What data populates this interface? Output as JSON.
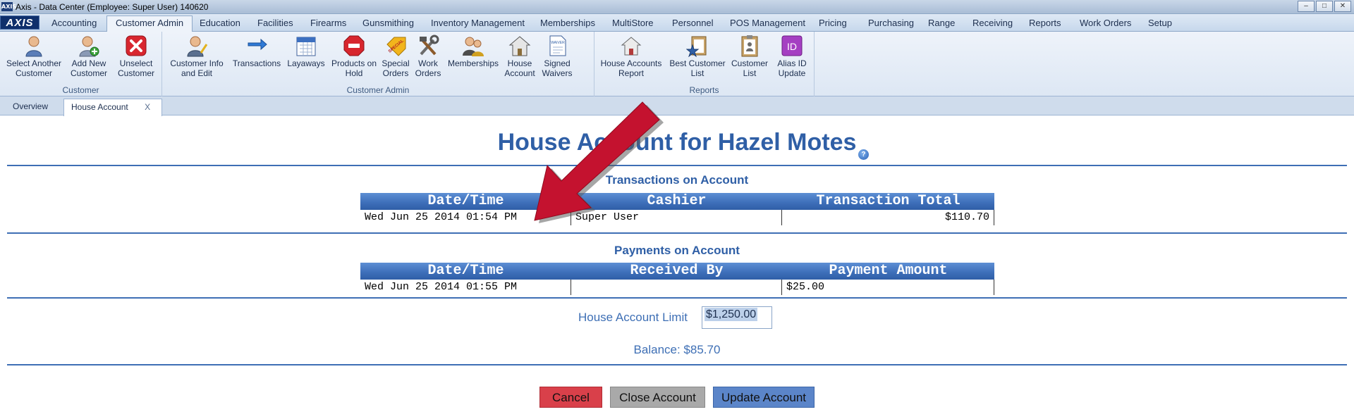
{
  "window": {
    "title": "Axis - Data Center  (Employee: Super User) 140620",
    "app_icon": "AXIS",
    "controls": {
      "minimize": "–",
      "maximize": "□",
      "close": "✕"
    }
  },
  "menu": {
    "logo": "AXIS",
    "tabs": [
      "Accounting",
      "Customer Admin",
      "Education",
      "Facilities",
      "Firearms",
      "Gunsmithing",
      "Inventory Management",
      "Memberships",
      "MultiStore",
      "Personnel",
      "POS Management",
      "Pricing",
      "Purchasing",
      "Range",
      "Receiving",
      "Reports",
      "Work Orders",
      "Setup"
    ],
    "active_tab": "Customer Admin"
  },
  "ribbon": {
    "groups": [
      {
        "label": "Customer",
        "buttons": [
          {
            "label": "Select Another\nCustomer",
            "icon": "person-icon"
          },
          {
            "label": "Add New\nCustomer",
            "icon": "add-person-icon"
          },
          {
            "label": "Unselect\nCustomer",
            "icon": "red-x-icon"
          }
        ]
      },
      {
        "label": "Customer Admin",
        "buttons": [
          {
            "label": "Customer Info\nand Edit",
            "icon": "person-edit-icon"
          },
          {
            "label": "Transactions",
            "icon": "arrows-icon"
          },
          {
            "label": "Layaways",
            "icon": "calendar-icon"
          },
          {
            "label": "Products on\nHold",
            "icon": "stop-sign-icon"
          },
          {
            "label": "Special\nOrders",
            "icon": "special-tag-icon"
          },
          {
            "label": "Work\nOrders",
            "icon": "tools-icon"
          },
          {
            "label": "Memberships",
            "icon": "members-icon"
          },
          {
            "label": "House\nAccount",
            "icon": "house-icon"
          },
          {
            "label": "Signed\nWaivers",
            "icon": "waiver-doc-icon"
          }
        ]
      },
      {
        "label": "Reports",
        "buttons": [
          {
            "label": "House Accounts\nReport",
            "icon": "house-report-icon"
          },
          {
            "label": "Best Customer\nList",
            "icon": "star-list-icon"
          },
          {
            "label": "Customer\nList",
            "icon": "clipboard-icon"
          },
          {
            "label": "Alias ID\nUpdate",
            "icon": "id-badge-icon"
          }
        ]
      }
    ],
    "id_badge_text": "ID",
    "waiver_text": "WAIVER",
    "special_text": "SPECIAL"
  },
  "doc_tabs": {
    "overview": "Overview",
    "active": "House Account",
    "close": "X"
  },
  "page": {
    "title": "House Account for Hazel Motes",
    "help": "?"
  },
  "transactions": {
    "title": "Transactions on Account",
    "headers": [
      "Date/Time",
      "Cashier",
      "Transaction Total"
    ],
    "rows": [
      [
        "Wed Jun 25 2014 01:54 PM",
        "Super User",
        "$110.70"
      ]
    ]
  },
  "payments": {
    "title": "Payments on Account",
    "headers": [
      "Date/Time",
      "Received By",
      "Payment Amount"
    ],
    "rows": [
      [
        "Wed Jun 25 2014 01:55 PM",
        "",
        "$25.00"
      ]
    ]
  },
  "limit": {
    "label": "House Account Limit",
    "value": "$1,250.00"
  },
  "balance": "Balance: $85.70",
  "buttons": {
    "cancel": "Cancel",
    "close_account": "Close Account",
    "update_account": "Update Account"
  },
  "colors": {
    "accent": "#2f5fa6",
    "annotation_arrow": "#c4122f",
    "cancel": "#d9404a",
    "update": "#5b85c9"
  }
}
